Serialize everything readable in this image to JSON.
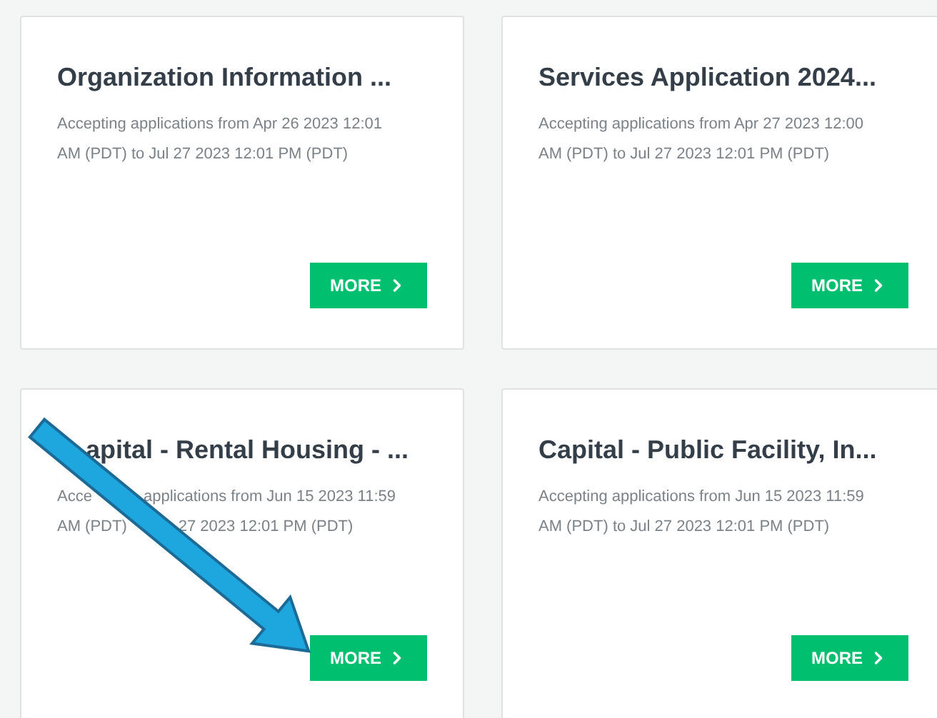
{
  "cards": [
    {
      "title": [
        {
          "kind": "text",
          "text": "Organization Information ..."
        }
      ],
      "description": [
        [
          {
            "kind": "text",
            "text": "Accepting applications from Apr 26 2023 12:01"
          }
        ],
        [
          {
            "kind": "text",
            "text": "AM (PDT) to Jul 27 2023 12:01 PM (PDT)"
          }
        ]
      ],
      "button": "MORE"
    },
    {
      "title": [
        {
          "kind": "text",
          "text": "Services Application 2024..."
        }
      ],
      "description": [
        [
          {
            "kind": "text",
            "text": "Accepting applications from Apr 27 2023 12:00"
          }
        ],
        [
          {
            "kind": "text",
            "text": "AM (PDT) to Jul 27 2023 12:01 PM (PDT)"
          }
        ]
      ],
      "button": "MORE"
    },
    {
      "title": [
        {
          "kind": "gap"
        },
        {
          "kind": "text",
          "text": "apital - Rental Housing - ..."
        }
      ],
      "description": [
        [
          {
            "kind": "text",
            "text": "Acce"
          },
          {
            "kind": "gap"
          },
          {
            "kind": "text",
            "text": "applications from Jun 15 2023 11:59"
          }
        ],
        [
          {
            "kind": "text",
            "text": "AM (PDT)"
          },
          {
            "kind": "gap"
          },
          {
            "kind": "text",
            "text": "27 2023 12:01 PM (PDT)"
          }
        ]
      ],
      "button": "MORE"
    },
    {
      "title": [
        {
          "kind": "text",
          "text": "Capital - Public Facility, In..."
        }
      ],
      "description": [
        [
          {
            "kind": "text",
            "text": "Accepting applications from Jun 15 2023 11:59"
          }
        ],
        [
          {
            "kind": "text",
            "text": "AM (PDT) to Jul 27 2023 12:01 PM (PDT)"
          }
        ]
      ],
      "button": "MORE"
    }
  ]
}
